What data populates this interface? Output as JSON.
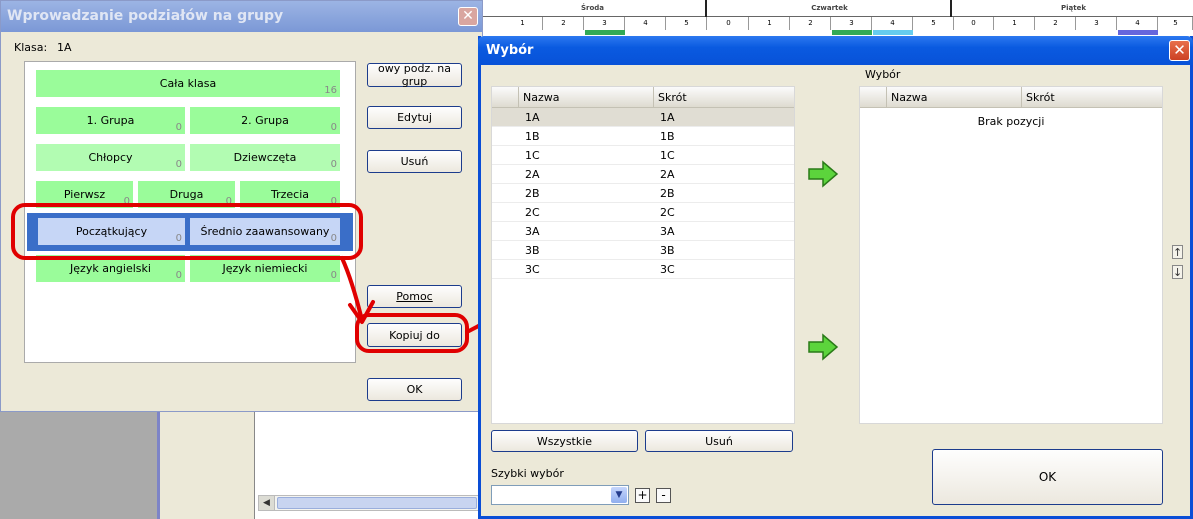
{
  "background": {
    "days": [
      "Środa",
      "Czwartek",
      "Piątek"
    ],
    "periods": [
      "1",
      "2",
      "3",
      "4",
      "5",
      "0",
      "1",
      "2",
      "3",
      "4",
      "5",
      "0",
      "1",
      "2",
      "3",
      "4",
      "5"
    ]
  },
  "dialog1": {
    "title": "Wprowadzanie podziałów na grupy",
    "close": "✕",
    "klasa_label": "Klasa:",
    "klasa_value": "1A",
    "groups": [
      {
        "label": "Cała klasa",
        "count": "16"
      },
      {
        "label": "1. Grupa",
        "count": "0"
      },
      {
        "label": "2. Grupa",
        "count": "0"
      },
      {
        "label": "Chłopcy",
        "count": "0"
      },
      {
        "label": "Dziewczęta",
        "count": "0"
      },
      {
        "label": "Pierwsz",
        "count": "0"
      },
      {
        "label": "Druga",
        "count": "0"
      },
      {
        "label": "Trzecia",
        "count": "0"
      },
      {
        "label": "Początkujący",
        "count": "0"
      },
      {
        "label": "Średnio zaawansowany",
        "count": "0"
      },
      {
        "label": "Język angielski",
        "count": "0"
      },
      {
        "label": "Język niemiecki",
        "count": "0"
      }
    ],
    "buttons": {
      "new": "owy podz. na grup",
      "edit": "Edytuj",
      "delete": "Usuń",
      "help": "Pomoc",
      "copy": "Kopiuj do",
      "ok": "OK"
    }
  },
  "dialog2": {
    "title": "Wybór",
    "close": "✕",
    "left_list": {
      "headers": [
        "Nazwa",
        "Skrót"
      ],
      "rows": [
        [
          "1A",
          "1A"
        ],
        [
          "1B",
          "1B"
        ],
        [
          "1C",
          "1C"
        ],
        [
          "2A",
          "2A"
        ],
        [
          "2B",
          "2B"
        ],
        [
          "2C",
          "2C"
        ],
        [
          "3A",
          "3A"
        ],
        [
          "3B",
          "3B"
        ],
        [
          "3C",
          "3C"
        ]
      ]
    },
    "right_label": "Wybór",
    "right_list": {
      "headers": [
        "Nazwa",
        "Skrót"
      ],
      "empty": "Brak pozycji"
    },
    "buttons": {
      "all": "Wszystkie",
      "remove": "Usuń",
      "ok": "OK"
    },
    "quick_select_label": "Szybki wybór",
    "quick_select_value": "",
    "plus": "+",
    "minus": "-",
    "up_arrow": "↑",
    "down_arrow": "↓"
  },
  "colors": {
    "group_green": "#9afc9a",
    "selection_blue": "#3a6ec8",
    "annotation_red": "#e00000",
    "title_active": "#0a5ae0"
  },
  "icons": [
    "close-icon",
    "green-arrow-right-icon",
    "up-arrow-icon",
    "down-arrow-icon",
    "chevron-down-icon",
    "plus-icon",
    "minus-icon"
  ]
}
